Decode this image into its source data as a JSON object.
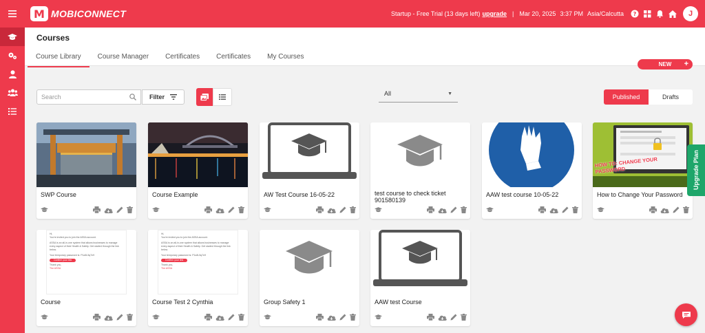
{
  "topbar": {
    "brand": "MOBICONNECT",
    "brand_badge": "M",
    "plan_text": "Startup - Free Trial (13 days left)",
    "upgrade_link": "upgrade",
    "date": "Mar 20, 2025",
    "time": "3:37 PM",
    "timezone": "Asia/Calcutta",
    "avatar_initial": "J"
  },
  "sidebar": {
    "items": [
      {
        "icon": "graduation-cap-icon",
        "active": true
      },
      {
        "icon": "gears-icon",
        "active": false
      },
      {
        "icon": "user-icon",
        "active": false
      },
      {
        "icon": "users-icon",
        "active": false
      },
      {
        "icon": "list-icon",
        "active": false
      }
    ]
  },
  "page": {
    "title": "Courses",
    "tabs": [
      "Course Library",
      "Course Manager",
      "Certificates",
      "Certificates",
      "My Courses"
    ],
    "active_tab": 0,
    "new_label": "NEW",
    "new_plus": "+"
  },
  "toolbar": {
    "search_placeholder": "Search",
    "filter_label": "Filter",
    "dropdown_value": "All",
    "published_label": "Published",
    "drafts_label": "Drafts"
  },
  "courses": [
    {
      "title": "SWP Course",
      "thumb": "container"
    },
    {
      "title": "Course Example",
      "thumb": "harbour"
    },
    {
      "title": "AW Test Course 16-05-22",
      "thumb": "laptop"
    },
    {
      "title": "test course to check ticket 901580139",
      "thumb": "cap"
    },
    {
      "title": "AAW test course 10-05-22",
      "thumb": "glove"
    },
    {
      "title": "How to Change Your Password",
      "thumb": "password"
    },
    {
      "title": "Course",
      "thumb": "email"
    },
    {
      "title": "Course Test 2 Cynthia",
      "thumb": "email"
    },
    {
      "title": "Group Safety 1",
      "thumb": "cap"
    },
    {
      "title": "AAW test Course",
      "thumb": "laptop"
    }
  ],
  "thumb_text": {
    "email_greeting": "Hi,",
    "email_line1": "You're invited you to join the ASSA account.",
    "email_line2": "ASSA is an all-in-one system that allows businesses to manage every aspect of their Health & Safety. Get started through the link below.",
    "email_line3": "Your temporary password is: P1a3L5q7n9",
    "email_button": "Confirm your link",
    "email_thanks": "Thank you,",
    "email_sign": "The ASSA",
    "password_banner": "HOW TO: CHANGE YOUR PASSWORD"
  },
  "upgrade_label": "Upgrade Plan",
  "colors": {
    "accent": "#ee3a4c",
    "green": "#1ea66a"
  }
}
